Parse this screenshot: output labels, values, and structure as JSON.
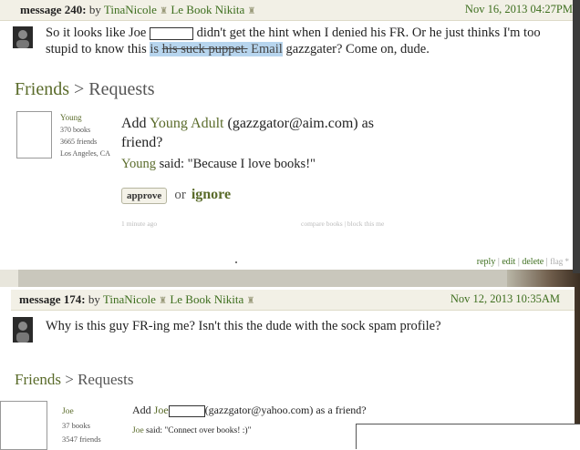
{
  "message1": {
    "header_prefix": "message 240:",
    "by": "by",
    "author": "TinaNicole",
    "group": "Le Book Nikita",
    "date": "Nov 16, 2013 04:27PM",
    "line1_a": "So it looks like Joe",
    "line1_b": "didn't get the hint when I denied his FR. Or he just thinks I'm too",
    "line2_a": "stupid to know this",
    "line2_highlight_a": "is",
    "line2_highlight_strike": "his suck puppet.",
    "line2_highlight_b": "Email",
    "line2_b": "gazzgater? Come on, dude."
  },
  "request1": {
    "title_friends": "Friends",
    "title_sep": ">",
    "title_requests": "Requests",
    "user_name": "Young",
    "user_books": "370 books",
    "user_friends": "3665 friends",
    "user_location": "Los Angeles, CA",
    "add_prefix": "Add",
    "add_name": "Young Adult",
    "add_email": "(gazzgator@aim.com) as",
    "add_suffix": "friend?",
    "said_name": "Young",
    "said_text": "said: \"Because I love books!\"",
    "approve_label": "approve",
    "or_label": "or",
    "ignore_label": "ignore",
    "time_ago": "1 minute ago",
    "compare_link": "compare books",
    "block_link": "block this me",
    "reply": "reply",
    "edit": "edit",
    "delete": "delete",
    "flag": "flag *",
    "sep": "|"
  },
  "message2": {
    "header_prefix": "message 174:",
    "by": "by",
    "author": "TinaNicole",
    "group": "Le Book Nikita",
    "date": "Nov 12, 2013 10:35AM",
    "text": "Why is this guy FR-ing me? Isn't this the dude with the sock spam profile?"
  },
  "request2": {
    "title_friends": "Friends",
    "title_sep": ">",
    "title_requests": "Requests",
    "user_name": "Joe",
    "user_books": "37 books",
    "user_friends": "3547 friends",
    "add_prefix": "Add",
    "add_name": "Joe",
    "add_email": "(gazzgator@yahoo.com) as a friend?",
    "said_name": "Joe",
    "said_text": "said: \"Connect over books! :)\""
  },
  "colors": {
    "link_green": "#5a6b2a",
    "date_green": "#3d6e1e",
    "header_bg": "#f2f0e6",
    "highlight": "#b7d5ee"
  },
  "icons": {
    "shield": "shield-icon",
    "avatar": "avatar-silhouette"
  }
}
